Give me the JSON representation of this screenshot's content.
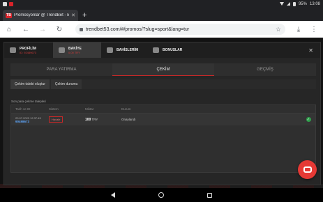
{
  "statusbar": {
    "battery": "95%",
    "time": "13:08"
  },
  "browser": {
    "tab_title": "Promosyonlar @ TrendBet - B",
    "favicon": "TB",
    "url": "trendbet53.com/#/promos/?slug=sport&lang=tur"
  },
  "header": {
    "profile_label": "PROFİLİM",
    "profile_sub": "ID: 92489673",
    "balance_label": "BAKİYE",
    "balance_sub": "0,00 TRY",
    "bets_label": "BAHİSLERİM",
    "bonus_label": "BONUSLAR"
  },
  "tabs": [
    {
      "label": "PARA YATIRMA"
    },
    {
      "label": "ÇEKİM"
    },
    {
      "label": "GEÇMİŞ"
    }
  ],
  "subtabs": [
    {
      "label": "Çekim talebi oluştur"
    },
    {
      "label": "Çekim durumu"
    }
  ],
  "section_title": "Son para çekme talepleri",
  "table": {
    "headers": [
      "Tarih ve ID",
      "Sistem",
      "Miktar",
      "Durum"
    ],
    "rows": [
      {
        "date": "20.07.2023 12:37:45",
        "id": "90498673",
        "system": "Havale",
        "amount": "100",
        "currency": "TRY",
        "status": "Onaylandı"
      }
    ]
  },
  "colors": {
    "accent": "#c62828",
    "success": "#2e9e4a",
    "chat": "#e53935"
  }
}
